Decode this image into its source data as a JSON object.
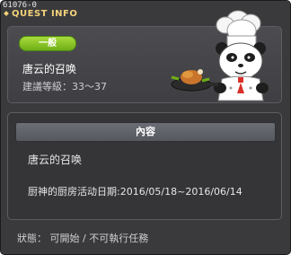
{
  "window": {
    "quest_id": "61076-0",
    "title": "QUEST INFO"
  },
  "header": {
    "category": "一般",
    "quest_name": "唐云的召唤",
    "level_text": "建議等級：33～37",
    "npc_icon": "chef-panda-icon"
  },
  "content": {
    "header": "內容",
    "line1": "唐云的召唤",
    "line2": "厨神的厨房活动日期:2016/05/18~2016/06/14"
  },
  "status": "狀態： 可開始 / 不可執行任務",
  "colors": {
    "title": "#f4d27a",
    "badge": "#8cc92a",
    "panel": "#3a3a3c"
  }
}
